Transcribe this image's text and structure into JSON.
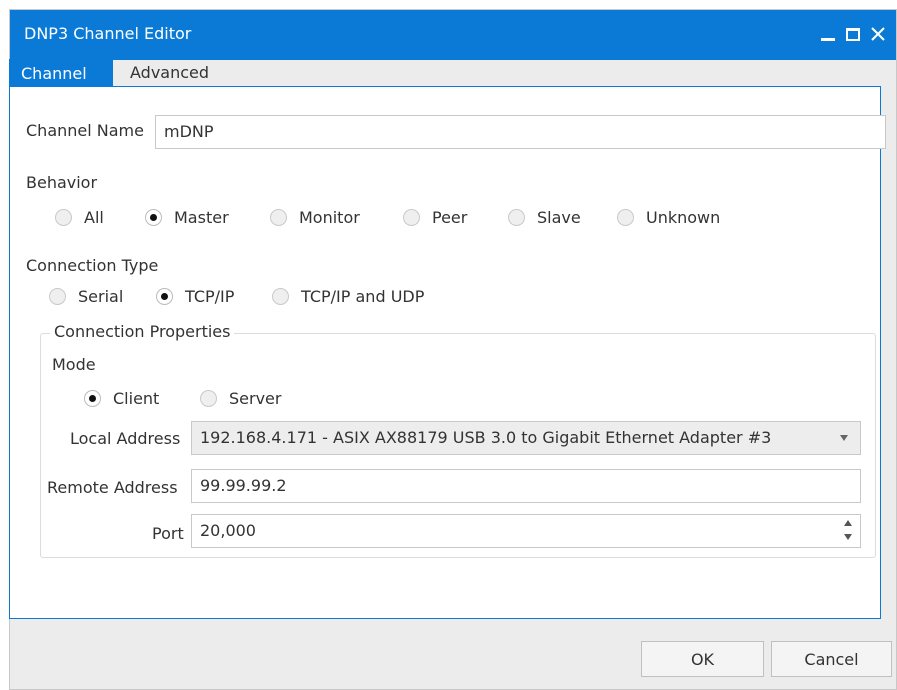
{
  "window": {
    "title": "DNP3 Channel Editor"
  },
  "tabs": [
    {
      "label": "Channel",
      "active": true
    },
    {
      "label": "Advanced",
      "active": false
    }
  ],
  "channel_name": {
    "label": "Channel Name",
    "value": "mDNP"
  },
  "behavior": {
    "label": "Behavior",
    "options": [
      "All",
      "Master",
      "Monitor",
      "Peer",
      "Slave",
      "Unknown"
    ],
    "selected": "Master"
  },
  "connection_type": {
    "label": "Connection Type",
    "options": [
      "Serial",
      "TCP/IP",
      "TCP/IP and UDP"
    ],
    "selected": "TCP/IP"
  },
  "connection_properties": {
    "legend": "Connection Properties",
    "mode": {
      "label": "Mode",
      "options": [
        "Client",
        "Server"
      ],
      "selected": "Client"
    },
    "local_address": {
      "label": "Local Address",
      "value": "192.168.4.171 - ASIX AX88179 USB 3.0 to Gigabit Ethernet Adapter #3"
    },
    "remote_address": {
      "label": "Remote Address",
      "value": "99.99.99.2"
    },
    "port": {
      "label": "Port",
      "value": "20,000"
    }
  },
  "buttons": {
    "ok": "OK",
    "cancel": "Cancel"
  },
  "colors": {
    "accent": "#0a7ad6",
    "window_bg": "#ececec",
    "field_border": "#c9c9c9"
  },
  "icons": {
    "minimize": "minimize-icon",
    "maximize": "maximize-icon",
    "close": "close-icon",
    "dropdown": "chevron-down-icon",
    "spin": "spin-arrows-icon"
  }
}
